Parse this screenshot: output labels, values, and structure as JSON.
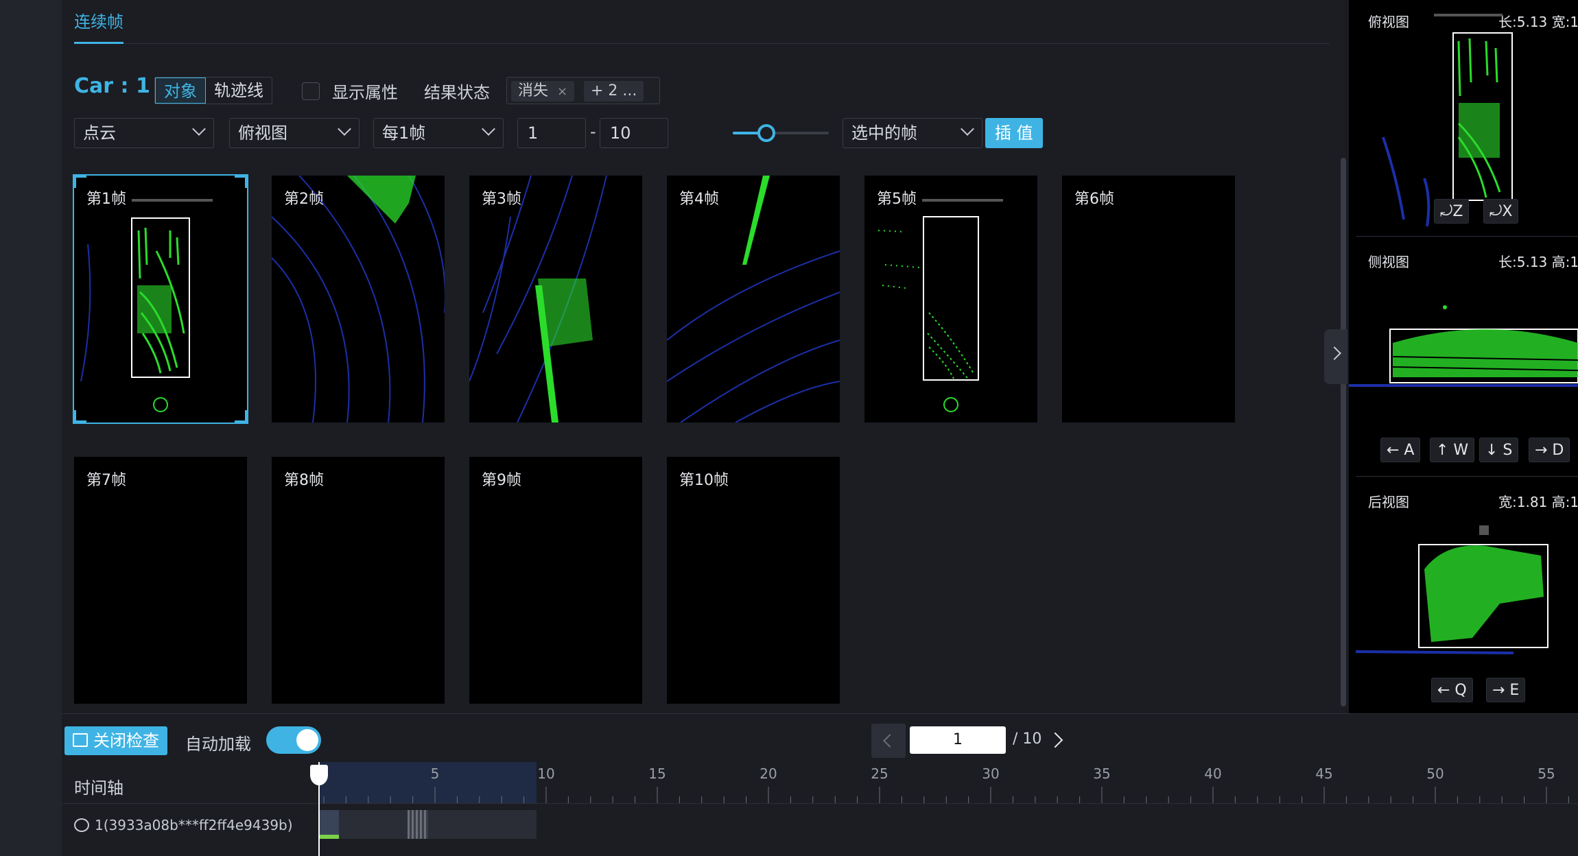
{
  "tab": {
    "label": "连续帧"
  },
  "toolbar": {
    "object_label": "Car : 1",
    "mode_object": "对象",
    "mode_track": "轨迹线",
    "show_attr_label": "显示属性",
    "result_state_label": "结果状态",
    "tag_vanish": "消失",
    "tag_vanish_close": "×",
    "tag_more": "+ 2 ..."
  },
  "filters": {
    "data_type": "点云",
    "view": "俯视图",
    "step": "每1帧",
    "range_from": "1",
    "range_sep": "-",
    "range_to": "10",
    "slider_value": 0.25,
    "frames_select": "选中的帧",
    "interpolate_button": "插 值"
  },
  "frames": [
    {
      "label": "第1帧"
    },
    {
      "label": "第2帧"
    },
    {
      "label": "第3帧"
    },
    {
      "label": "第4帧"
    },
    {
      "label": "第5帧"
    },
    {
      "label": "第6帧"
    },
    {
      "label": "第7帧"
    },
    {
      "label": "第8帧"
    },
    {
      "label": "第9帧"
    },
    {
      "label": "第10帧"
    }
  ],
  "right_panel": {
    "top_view": {
      "title": "俯视图",
      "dims": "长:5.13 宽:1",
      "btn_z": "⤾Z",
      "btn_x": "⤾X"
    },
    "side_view": {
      "title": "侧视图",
      "dims": "长:5.13 高:1",
      "btn_a": "← A",
      "btn_w": "↑ W",
      "btn_s": "↓ S",
      "btn_d": "→ D"
    },
    "back_view": {
      "title": "后视图",
      "dims": "宽:1.81 高:1",
      "btn_q": "← Q",
      "btn_e": "→ E"
    }
  },
  "bottom": {
    "close_check_button": "关闭检查",
    "auto_load_label": "自动加载",
    "auto_load_enabled": true,
    "page_current": "1",
    "page_total": "/ 10",
    "timeline_label": "时间轴",
    "timeline_ticks": [
      "5",
      "10",
      "15",
      "20",
      "25",
      "30",
      "35",
      "40",
      "45",
      "50",
      "55"
    ],
    "track_label": "1(3933a08b***ff2ff4e9439b)"
  },
  "colors": {
    "accent": "#3fb4e4",
    "points": "#2bdc2b",
    "lidar_rings": "#1c2fa8"
  }
}
